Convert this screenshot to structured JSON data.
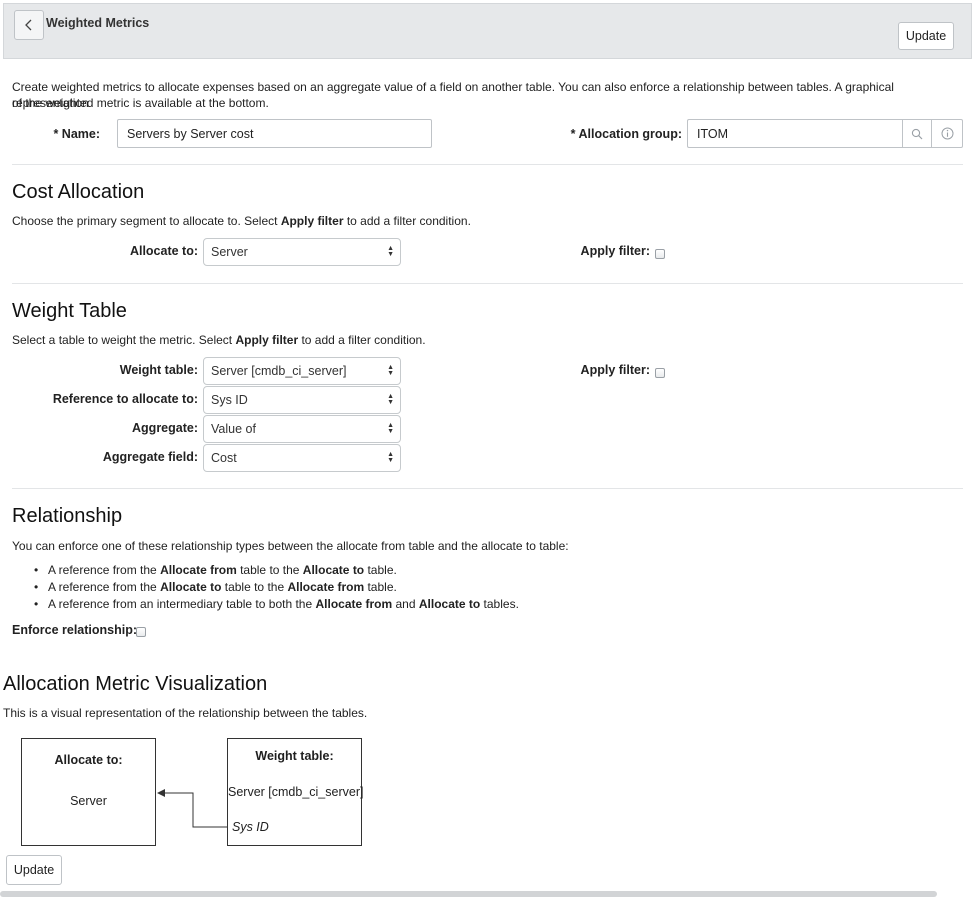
{
  "header": {
    "title": "Weighted Metrics",
    "update_label": "Update"
  },
  "intro": {
    "line1": "Create weighted metrics to allocate expenses based on an aggregate value of a field on another table. You can also enforce a relationship between tables. A graphical representation",
    "line2": "of the weighted metric is available at the bottom."
  },
  "form": {
    "name_label": "* Name:",
    "name_value": "Servers by Server cost",
    "allocation_group_label": "* Allocation group:",
    "allocation_group_value": "ITOM"
  },
  "cost_allocation": {
    "heading": "Cost Allocation",
    "desc_pre": "Choose the primary segment to allocate to. Select ",
    "desc_bold": "Apply filter",
    "desc_post": " to add a filter condition.",
    "allocate_to_label": "Allocate to:",
    "allocate_to_value": "Server",
    "apply_filter_label": "Apply filter:"
  },
  "weight_table": {
    "heading": "Weight Table",
    "desc_pre": "Select a table to weight the metric. Select ",
    "desc_bold": "Apply filter",
    "desc_post": " to add a filter condition.",
    "weight_table_label": "Weight table:",
    "weight_table_value": "Server [cmdb_ci_server]",
    "reference_label": "Reference to allocate to:",
    "reference_value": "Sys ID",
    "aggregate_label": "Aggregate:",
    "aggregate_value": "Value of",
    "aggregate_field_label": "Aggregate field:",
    "aggregate_field_value": "Cost",
    "apply_filter_label": "Apply filter:"
  },
  "relationship": {
    "heading": "Relationship",
    "desc": "You can enforce one of these relationship types between the allocate from table and the allocate to table:",
    "bullet1": {
      "t1": "A reference from the ",
      "b1": "Allocate from",
      "t2": " table to the  ",
      "b2": "Allocate to",
      "t3": " table."
    },
    "bullet2": {
      "t1": "A reference from the ",
      "b1": "Allocate to",
      "t2": " table to the ",
      "b2": "Allocate from",
      "t3": " table."
    },
    "bullet3": {
      "t1": "A reference from an intermediary table to both the ",
      "b1": "Allocate from",
      "t2": " and ",
      "b2": "Allocate to",
      "t3": " tables."
    },
    "enforce_label": "Enforce relationship:"
  },
  "visualization": {
    "heading": "Allocation Metric Visualization",
    "desc": "This is a visual representation of the relationship between the tables.",
    "left_box_title": "Allocate to:",
    "left_box_value": "Server",
    "right_box_title": "Weight table:",
    "right_box_value": "Server [cmdb_ci_server]",
    "right_box_field": "Sys ID"
  },
  "footer": {
    "update_label": "Update"
  },
  "icons": {
    "back": "chevron-left-icon",
    "search": "search-icon",
    "info": "info-icon"
  },
  "colors": {
    "header_bg": "#e6e8ea",
    "border": "#bfc3c7",
    "text": "#222222"
  }
}
